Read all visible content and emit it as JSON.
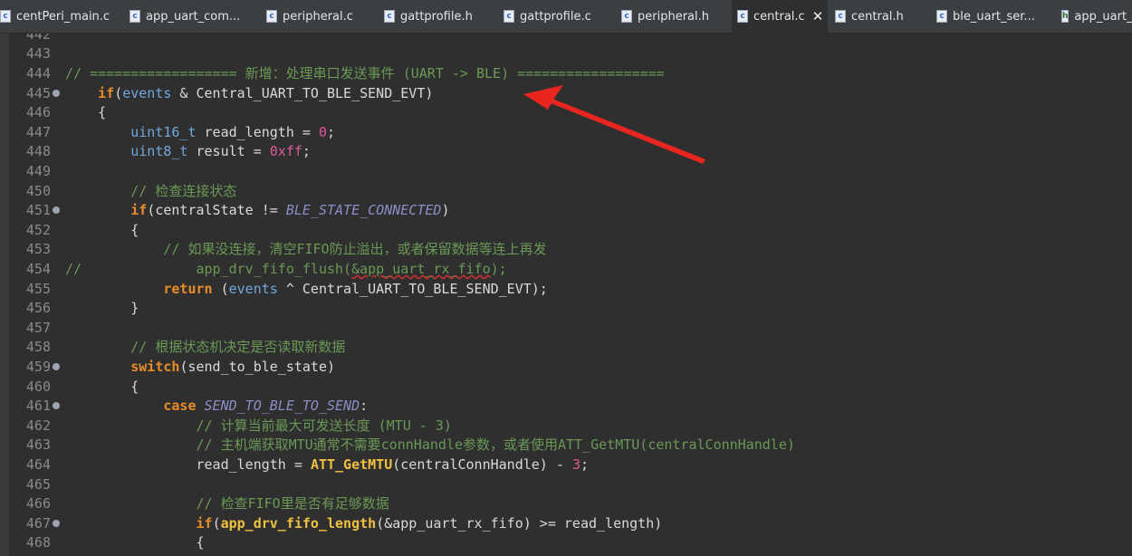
{
  "tabs": [
    {
      "label": "centPeri_main.c",
      "icon": "c-file-icon",
      "active": false
    },
    {
      "label": "app_uart_com...",
      "icon": "c-file-icon",
      "active": false
    },
    {
      "label": "peripheral.c",
      "icon": "c-file-icon",
      "active": false
    },
    {
      "label": "gattprofile.h",
      "icon": "c-file-icon",
      "active": false
    },
    {
      "label": "gattprofile.c",
      "icon": "c-file-icon",
      "active": false
    },
    {
      "label": "peripheral.h",
      "icon": "c-file-icon",
      "active": false
    },
    {
      "label": "central.c",
      "icon": "c-file-icon",
      "active": true
    },
    {
      "label": "central.h",
      "icon": "c-file-icon",
      "active": false
    },
    {
      "label": "ble_uart_ser...",
      "icon": "c-file-icon",
      "active": false
    },
    {
      "label": "app_uart_c",
      "icon": "h-file-icon",
      "active": false
    }
  ],
  "close_glyph": "✕",
  "editor": {
    "line_numbers": [
      "442",
      "443",
      "444",
      "445",
      "446",
      "447",
      "448",
      "449",
      "450",
      "451",
      "452",
      "453",
      "454",
      "455",
      "456",
      "457",
      "458",
      "459",
      "460",
      "461",
      "462",
      "463",
      "464",
      "465",
      "466",
      "467",
      "468"
    ],
    "fold_markers": [
      "445",
      "451",
      "459",
      "461",
      "467"
    ],
    "lines": [
      {
        "n": "442",
        "parts": []
      },
      {
        "n": "443",
        "parts": []
      },
      {
        "n": "444",
        "parts": [
          {
            "t": "// ================== 新增：处理串口发送事件 (UART -> BLE) ==================",
            "c": "cm"
          }
        ]
      },
      {
        "n": "445",
        "parts": [
          {
            "t": "    "
          },
          {
            "t": "if",
            "c": "kw"
          },
          {
            "t": "("
          },
          {
            "t": "events",
            "c": "ty"
          },
          {
            "t": " & Central_UART_TO_BLE_SEND_EVT)"
          }
        ]
      },
      {
        "n": "446",
        "parts": [
          {
            "t": "    {"
          }
        ]
      },
      {
        "n": "447",
        "parts": [
          {
            "t": "        "
          },
          {
            "t": "uint16_t",
            "c": "ty"
          },
          {
            "t": " read_length = "
          },
          {
            "t": "0",
            "c": "num"
          },
          {
            "t": ";"
          }
        ]
      },
      {
        "n": "448",
        "parts": [
          {
            "t": "        "
          },
          {
            "t": "uint8_t",
            "c": "ty"
          },
          {
            "t": " result = "
          },
          {
            "t": "0xff",
            "c": "num"
          },
          {
            "t": ";"
          }
        ]
      },
      {
        "n": "449",
        "parts": []
      },
      {
        "n": "450",
        "parts": [
          {
            "t": "        "
          },
          {
            "t": "// 检查连接状态",
            "c": "cm"
          }
        ]
      },
      {
        "n": "451",
        "parts": [
          {
            "t": "        "
          },
          {
            "t": "if",
            "c": "kw"
          },
          {
            "t": "(centralState != "
          },
          {
            "t": "BLE_STATE_CONNECTED",
            "c": "cst"
          },
          {
            "t": ")"
          }
        ]
      },
      {
        "n": "452",
        "parts": [
          {
            "t": "        {"
          }
        ]
      },
      {
        "n": "453",
        "parts": [
          {
            "t": "            "
          },
          {
            "t": "// 如果没连接，清空FIFO防止溢出，或者保留数据等连上再发",
            "c": "cm"
          }
        ]
      },
      {
        "n": "454",
        "parts": [
          {
            "t": "//              app_drv_fifo_flush(",
            "c": "cm"
          },
          {
            "t": "&app_uart_rx_fifo",
            "c": "cm squig"
          },
          {
            "t": ");",
            "c": "cm"
          }
        ]
      },
      {
        "n": "455",
        "parts": [
          {
            "t": "            "
          },
          {
            "t": "return",
            "c": "kw"
          },
          {
            "t": " ("
          },
          {
            "t": "events",
            "c": "ty"
          },
          {
            "t": " ^ Central_UART_TO_BLE_SEND_EVT);"
          }
        ]
      },
      {
        "n": "456",
        "parts": [
          {
            "t": "        }"
          }
        ]
      },
      {
        "n": "457",
        "parts": []
      },
      {
        "n": "458",
        "parts": [
          {
            "t": "        "
          },
          {
            "t": "// 根据状态机决定是否读取新数据",
            "c": "cm"
          }
        ]
      },
      {
        "n": "459",
        "parts": [
          {
            "t": "        "
          },
          {
            "t": "switch",
            "c": "kw"
          },
          {
            "t": "(send_to_ble_state)"
          }
        ]
      },
      {
        "n": "460",
        "parts": [
          {
            "t": "        {"
          }
        ]
      },
      {
        "n": "461",
        "parts": [
          {
            "t": "            "
          },
          {
            "t": "case",
            "c": "kw"
          },
          {
            "t": " "
          },
          {
            "t": "SEND_TO_BLE_TO_SEND",
            "c": "cst"
          },
          {
            "t": ":"
          }
        ]
      },
      {
        "n": "462",
        "parts": [
          {
            "t": "                "
          },
          {
            "t": "// 计算当前最大可发送长度 (MTU - 3)",
            "c": "cm"
          }
        ]
      },
      {
        "n": "463",
        "parts": [
          {
            "t": "                "
          },
          {
            "t": "// 主机端获取MTU通常不需要connHandle参数，或者使用ATT_GetMTU(centralConnHandle)",
            "c": "cm"
          }
        ]
      },
      {
        "n": "464",
        "parts": [
          {
            "t": "                read_length = "
          },
          {
            "t": "ATT_GetMTU",
            "c": "fn"
          },
          {
            "t": "(centralConnHandle) - "
          },
          {
            "t": "3",
            "c": "num"
          },
          {
            "t": ";"
          }
        ]
      },
      {
        "n": "465",
        "parts": []
      },
      {
        "n": "466",
        "parts": [
          {
            "t": "                "
          },
          {
            "t": "// 检查FIFO里是否有足够数据",
            "c": "cm"
          }
        ]
      },
      {
        "n": "467",
        "parts": [
          {
            "t": "                "
          },
          {
            "t": "if",
            "c": "kw"
          },
          {
            "t": "("
          },
          {
            "t": "app_drv_fifo_length",
            "c": "fn"
          },
          {
            "t": "(&app_uart_rx_fifo) >= read_length)"
          }
        ]
      },
      {
        "n": "468",
        "parts": [
          {
            "t": "                {"
          }
        ]
      }
    ]
  },
  "annotation": {
    "type": "red-arrow",
    "color": "#e8261f",
    "points_to_line": "445"
  }
}
